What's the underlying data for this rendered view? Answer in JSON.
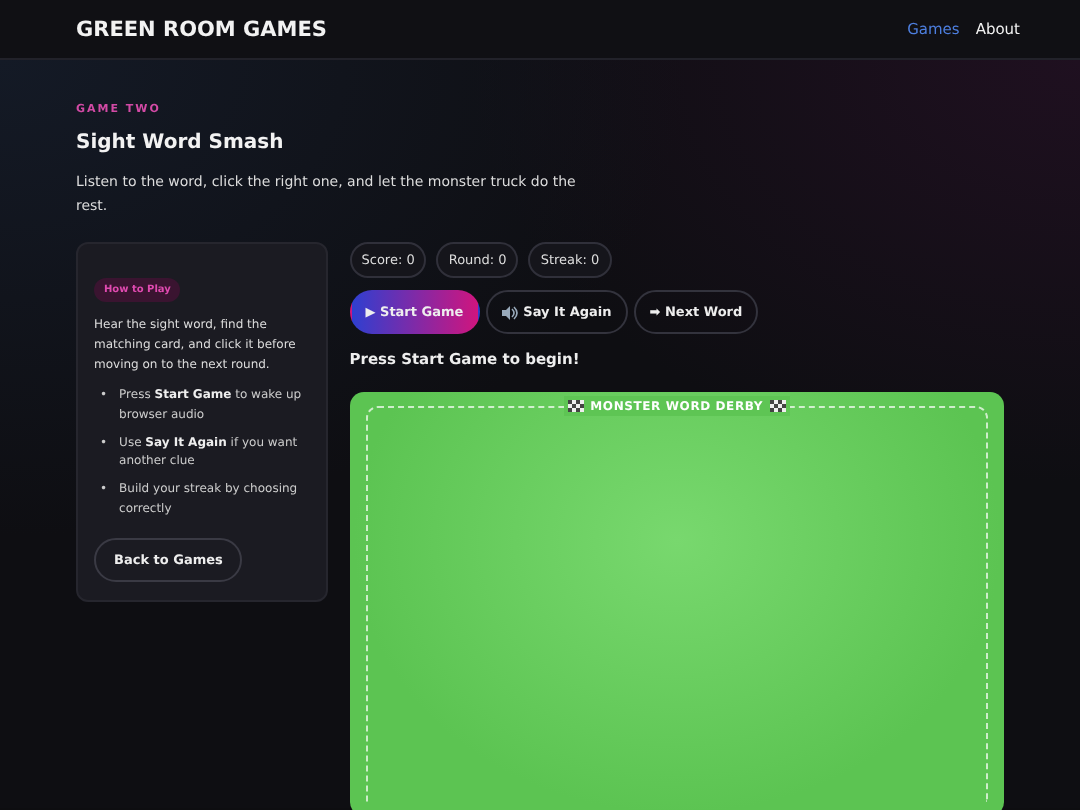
{
  "header": {
    "brand": "GREEN ROOM GAMES",
    "nav": [
      {
        "label": "Games",
        "selected": true
      },
      {
        "label": "About",
        "selected": false
      }
    ]
  },
  "hero": {
    "eyebrow": "GAME TWO",
    "title": "Sight Word Smash",
    "intro": "Listen to the word, click the right one, and let the monster truck do the rest."
  },
  "how_to_play": {
    "badge": "How to Play",
    "description": "Hear the sight word, find the matching card, and click it before moving on to the next round.",
    "tips": [
      {
        "bullet": "•",
        "text": "Press **Start Game** to wake up browser audio"
      },
      {
        "bullet": "•",
        "text": "Use **Say It Again** if you want another clue"
      },
      {
        "bullet": "•",
        "text": "Build your streak by choosing correctly"
      }
    ],
    "back_button": "Back to Games"
  },
  "stats": [
    "Score: 0",
    "Round: 0",
    "Streak: 0"
  ],
  "controls": [
    {
      "kind": "primary",
      "label": "▶ Start Game"
    },
    {
      "kind": "speaker",
      "label": "Say It Again"
    },
    {
      "kind": "plain",
      "label": "➡ Next Word"
    }
  ],
  "status": "Press Start Game to begin!",
  "arena": {
    "title": "MONSTER WORD DERBY"
  }
}
